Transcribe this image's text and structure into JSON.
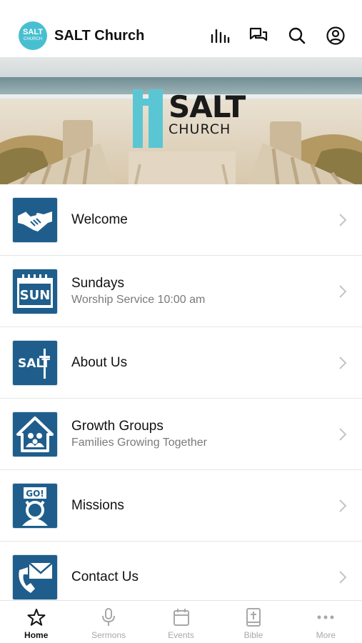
{
  "app": {
    "title": "SALT Church",
    "logo_text": "SALT",
    "logo_subtext": "CHURCH"
  },
  "header_icons": [
    "stats-icon",
    "chat-icon",
    "search-icon",
    "profile-icon"
  ],
  "banner": {
    "title": "SALT",
    "subtitle": "CHURCH"
  },
  "menu": [
    {
      "title": "Welcome",
      "subtitle": "",
      "icon": "handshake-icon"
    },
    {
      "title": "Sundays",
      "subtitle": "Worship Service 10:00 am",
      "icon": "calendar-sun-icon",
      "icon_text": "SUN"
    },
    {
      "title": "About Us",
      "subtitle": "",
      "icon": "salt-logo-icon",
      "icon_text": "SALT"
    },
    {
      "title": "Growth Groups",
      "subtitle": "Families Growing Together",
      "icon": "house-family-icon"
    },
    {
      "title": "Missions",
      "subtitle": "",
      "icon": "go-person-icon",
      "icon_text": "GO!"
    },
    {
      "title": "Contact Us",
      "subtitle": "",
      "icon": "phone-mail-icon"
    }
  ],
  "tabs": [
    {
      "label": "Home",
      "icon": "star-icon",
      "active": true
    },
    {
      "label": "Sermons",
      "icon": "microphone-icon",
      "active": false
    },
    {
      "label": "Events",
      "icon": "calendar-icon",
      "active": false
    },
    {
      "label": "Bible",
      "icon": "bible-icon",
      "active": false
    },
    {
      "label": "More",
      "icon": "more-dots-icon",
      "active": false
    }
  ],
  "colors": {
    "tile_blue": "#1f5e8c",
    "logo_teal": "#48bfd0",
    "inactive_tab": "#a8a8a8",
    "subtitle_gray": "#7a7a7a"
  }
}
